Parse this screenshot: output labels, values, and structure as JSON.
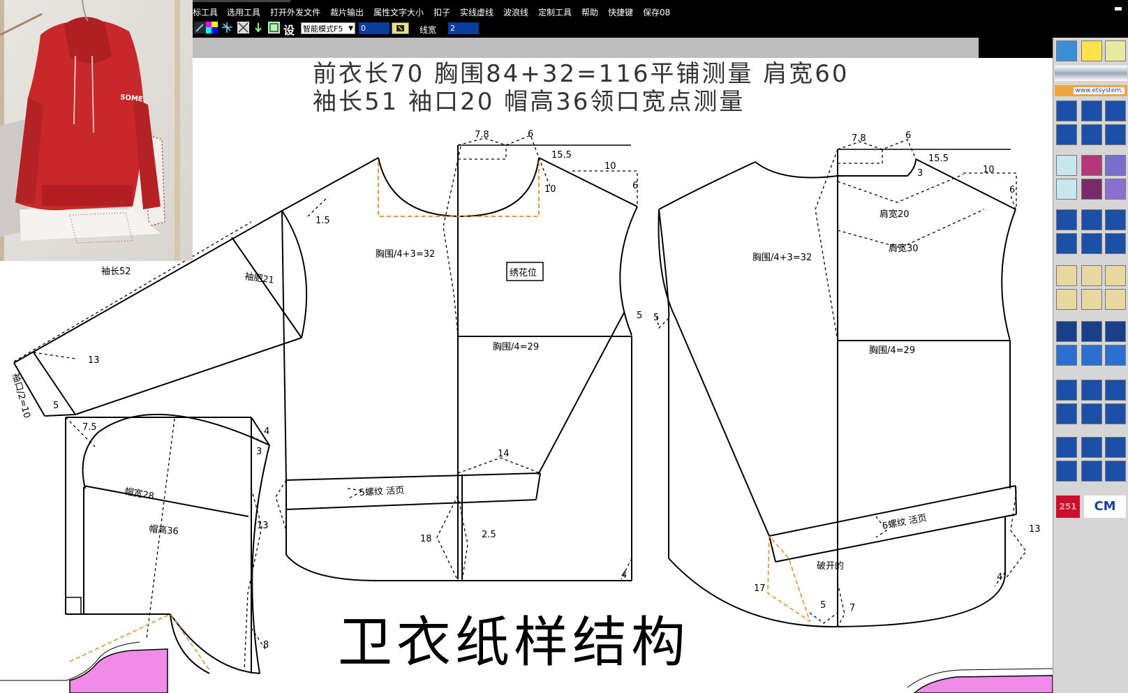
{
  "menu": {
    "items": [
      "标工具",
      "选用工具",
      "打开外发文件",
      "裁片输出",
      "属性文字大小",
      "扣子",
      "实线虚线",
      "波浪线",
      "定制工具",
      "帮助",
      "快捷键",
      "保存08"
    ],
    "win_min": "▬"
  },
  "toolbar": {
    "mode_label": "智能模式F5",
    "value1": "0",
    "linewidth_label": "线宽",
    "value2": "2",
    "set_glyph": "设"
  },
  "palette": {
    "logo_text": "www.etsystem.",
    "counter": "251",
    "unit": "CM"
  },
  "headings": {
    "line1": "前衣长70   胸围84+32=116平铺测量   肩宽60",
    "line2": "袖长51   袖口20   帽高36领口宽点测量",
    "title": "卫衣纸样结构"
  },
  "photo": {
    "print_text": "SOME"
  },
  "labels": {
    "front_neck_w": "7.8",
    "front_neck_d": "6",
    "front_shoulder": "15.5",
    "front_10": "10",
    "front_6": "6",
    "front_10b": "10",
    "front_1_5": "1.5",
    "front_chest": "胸围/4+3=32",
    "embroidery": "绣花位",
    "front_5": "5",
    "front_chest2": "胸围/4=29",
    "front_14": "14",
    "front_rib": "5螺纹   活页",
    "front_13": "13",
    "front_18": "18",
    "front_2_5": "2.5",
    "front_4": "4",
    "sleeve_len": "袖长52",
    "sleeve_w": "袖肥21",
    "sleeve_13": "13",
    "cuff": "袖口/2=10",
    "cuff_5": "5",
    "hood_7_5": "7.5",
    "hood_4": "4",
    "hood_3": "3",
    "hood_w": "帽宽28",
    "hood_h": "帽高36",
    "hood_8": "8",
    "back_neck_w": "7.8",
    "back_neck_d": "6",
    "back_shoulder": "15.5",
    "back_3": "3",
    "back_10": "10",
    "back_6": "6",
    "back_sh20": "肩宽20",
    "back_sh30": "肩宽30",
    "back_chest": "胸围/4+3=32",
    "back_5": "5",
    "back_chest2": "胸围/4=29",
    "back_rib": "5螺纹   活页",
    "back_13": "13",
    "back_slit": "破开的",
    "back_4": "4",
    "back_17": "17",
    "back_5b": "5",
    "back_7": "7"
  }
}
